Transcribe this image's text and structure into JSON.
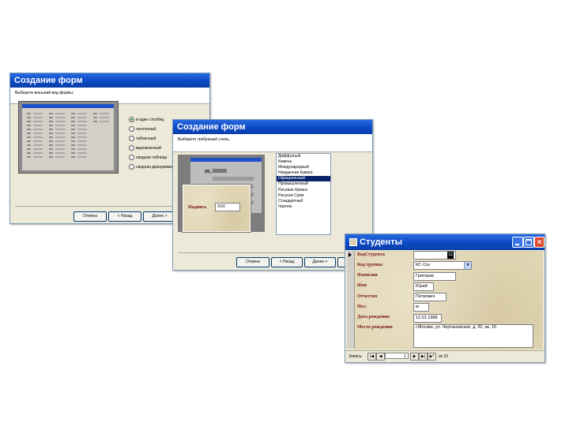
{
  "wizard1": {
    "title": "Создание форм",
    "prompt": "Выберите внешний вид формы:",
    "options": [
      "в один столбец",
      "ленточный",
      "табличный",
      "выровненный",
      "сводная таблица",
      "сводная диаграмма"
    ],
    "buttons": {
      "cancel": "Отмена",
      "back": "< Назад",
      "next": "Далее >"
    }
  },
  "wizard2": {
    "title": "Создание форм",
    "prompt": "Выберите требуемый стиль.",
    "preview_label": "Надпись",
    "preview_value": "XXX",
    "preview_field": "XXX",
    "styles": [
      "Диффузный",
      "Камень",
      "Международный",
      "Наждачная бумага",
      "Официальный",
      "Промышленный",
      "Рисовая бумага",
      "Рисунок Суми",
      "Стандартный",
      "Чертеж"
    ],
    "selected_style": "Официальный",
    "buttons": {
      "cancel": "Отмена",
      "back": "< Назад",
      "next": "Далее >"
    }
  },
  "form": {
    "title": "Студенты",
    "fields": [
      {
        "label": "КодСтудента",
        "value": "11"
      },
      {
        "label": "Код группы",
        "value": "КС-11а"
      },
      {
        "label": "Фамилия",
        "value": "Григоров"
      },
      {
        "label": "Имя",
        "value": "Юрий"
      },
      {
        "label": "Отчество",
        "value": "Петрович"
      },
      {
        "label": "Пол",
        "value": "м"
      },
      {
        "label": "Дата рождения",
        "value": "12.01.1988"
      },
      {
        "label": "Место рождения",
        "value": "г.Москва, ул. Чертановская, д. 20, кв. 15"
      }
    ],
    "nav": {
      "label": "Запись:",
      "current": "1",
      "total_text": "из 15"
    }
  }
}
